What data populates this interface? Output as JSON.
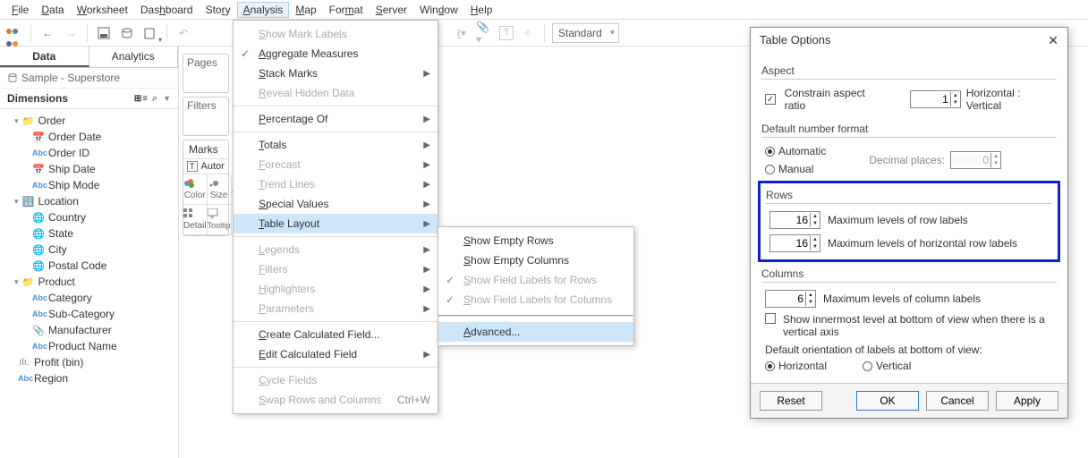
{
  "menubar": [
    "File",
    "Data",
    "Worksheet",
    "Dashboard",
    "Story",
    "Analysis",
    "Map",
    "Format",
    "Server",
    "Window",
    "Help"
  ],
  "menubar_underline": [
    0,
    0,
    0,
    3,
    3,
    0,
    0,
    3,
    0,
    3,
    0
  ],
  "menubar_open": "Analysis",
  "toolbar": {
    "standard": "Standard"
  },
  "sidepanel": {
    "tabs": [
      "Data",
      "Analytics"
    ],
    "active_tab": "Data",
    "datasource": "Sample - Superstore",
    "dim_header": "Dimensions",
    "tree": [
      {
        "lvl": 0,
        "chev": "▾",
        "ico": "folder",
        "label": "Order"
      },
      {
        "lvl": 1,
        "ico": "cal",
        "label": "Order Date"
      },
      {
        "lvl": 1,
        "ico": "abc",
        "label": "Order ID"
      },
      {
        "lvl": 1,
        "ico": "cal",
        "label": "Ship Date"
      },
      {
        "lvl": 1,
        "ico": "abc",
        "label": "Ship Mode"
      },
      {
        "lvl": 0,
        "chev": "▾",
        "ico": "loc",
        "label": "Location"
      },
      {
        "lvl": 1,
        "ico": "globe",
        "label": "Country"
      },
      {
        "lvl": 1,
        "ico": "globe",
        "label": "State"
      },
      {
        "lvl": 1,
        "ico": "globe",
        "label": "City"
      },
      {
        "lvl": 1,
        "ico": "globe",
        "label": "Postal Code"
      },
      {
        "lvl": 0,
        "chev": "▾",
        "ico": "folder",
        "label": "Product"
      },
      {
        "lvl": 1,
        "ico": "abc",
        "label": "Category"
      },
      {
        "lvl": 1,
        "ico": "abc",
        "label": "Sub-Category"
      },
      {
        "lvl": 1,
        "ico": "clip",
        "label": "Manufacturer"
      },
      {
        "lvl": 1,
        "ico": "abc",
        "label": "Product Name"
      },
      {
        "lvl": 0,
        "ico": "bar",
        "label": "Profit (bin)"
      },
      {
        "lvl": 0,
        "ico": "abc",
        "label": "Region"
      }
    ]
  },
  "shelves": {
    "pages": "Pages",
    "filters": "Filters",
    "marks": "Marks",
    "auto": "Automatic",
    "color": "Color",
    "size": "Size",
    "text": "Text",
    "detail": "Detail",
    "tooltip": "Tooltip"
  },
  "menu": {
    "items": [
      {
        "label": "Show Mark Labels",
        "disabled": true
      },
      {
        "label": "Aggregate Measures",
        "checked": true
      },
      {
        "label": "Stack Marks",
        "sub": true
      },
      {
        "label": "Reveal Hidden Data",
        "disabled": true
      },
      {
        "sep": true
      },
      {
        "label": "Percentage Of",
        "sub": true
      },
      {
        "sep": true
      },
      {
        "label": "Totals",
        "sub": true
      },
      {
        "label": "Forecast",
        "sub": true,
        "disabled": true
      },
      {
        "label": "Trend Lines",
        "sub": true,
        "disabled": true
      },
      {
        "label": "Special Values",
        "sub": true
      },
      {
        "label": "Table Layout",
        "sub": true,
        "hl": true
      },
      {
        "sep": true
      },
      {
        "label": "Legends",
        "sub": true,
        "disabled": true
      },
      {
        "label": "Filters",
        "sub": true,
        "disabled": true
      },
      {
        "label": "Highlighters",
        "sub": true,
        "disabled": true
      },
      {
        "label": "Parameters",
        "sub": true,
        "disabled": true
      },
      {
        "sep": true
      },
      {
        "label": "Create Calculated Field..."
      },
      {
        "label": "Edit Calculated Field",
        "sub": true
      },
      {
        "sep": true
      },
      {
        "label": "Cycle Fields",
        "disabled": true
      },
      {
        "label": "Swap Rows and Columns",
        "disabled": true,
        "kbd": "Ctrl+W"
      }
    ]
  },
  "submenu": [
    {
      "label": "Show Empty Rows"
    },
    {
      "label": "Show Empty Columns"
    },
    {
      "label": "Show Field Labels for Rows",
      "checked": true,
      "disabled": true
    },
    {
      "label": "Show Field Labels for Columns",
      "checked": true,
      "disabled": true
    },
    {
      "sep": true
    },
    {
      "label": "Advanced...",
      "hl": true
    }
  ],
  "dialog": {
    "title": "Table Options",
    "aspect": {
      "label": "Aspect",
      "check_label": "Constrain aspect ratio",
      "val": "1",
      "ratio": "Horizontal : Vertical"
    },
    "numfmt": {
      "label": "Default number format",
      "auto": "Automatic",
      "manual": "Manual",
      "dec_label": "Decimal places:",
      "dec_val": "0"
    },
    "rows": {
      "label": "Rows",
      "v1": "16",
      "l1": "Maximum levels of row labels",
      "v2": "16",
      "l2": "Maximum levels of horizontal row labels"
    },
    "cols": {
      "label": "Columns",
      "v1": "6",
      "l1": "Maximum levels of column labels",
      "inner": "Show innermost level at bottom of view when there is a vertical axis",
      "orient": "Default orientation of labels at bottom of view:",
      "h": "Horizontal",
      "v": "Vertical"
    },
    "btns": {
      "reset": "Reset",
      "ok": "OK",
      "cancel": "Cancel",
      "apply": "Apply"
    }
  }
}
